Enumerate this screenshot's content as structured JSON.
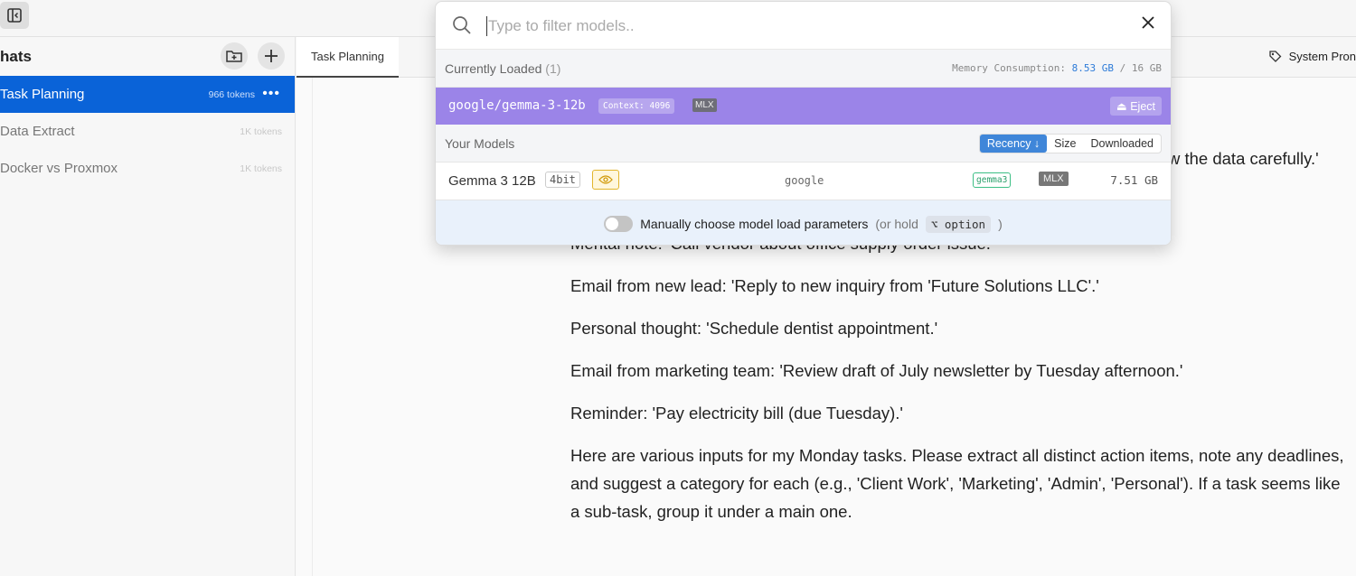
{
  "sidebar": {
    "title": "hats",
    "chats": [
      {
        "name": "Task Planning",
        "tokens": "966 tokens",
        "active": true
      },
      {
        "name": "Data Extract",
        "tokens": "1K tokens",
        "active": false
      },
      {
        "name": "Docker vs Proxmox",
        "tokens": "1K tokens",
        "active": false
      }
    ]
  },
  "tabs": {
    "active": "Task Planning"
  },
  "header": {
    "system_prompt": "System Pron"
  },
  "picker": {
    "search_placeholder": "Type to filter models..",
    "loaded_section": {
      "label": "Currently Loaded",
      "count": "(1)",
      "memory_label": "Memory Consumption:",
      "memory_used": "8.53 GB",
      "memory_sep": "/",
      "memory_total": "16 GB"
    },
    "loaded_model": {
      "name": "google/gemma-3-12b",
      "context": "Context: 4096",
      "format": "MLX",
      "eject": "Eject"
    },
    "your_models": {
      "label": "Your Models",
      "sort_options": [
        "Recency ↓",
        "Size",
        "Downloaded"
      ],
      "active_sort": "Recency ↓"
    },
    "models": [
      {
        "name": "Gemma 3 12B",
        "quant": "4bit",
        "publisher": "google",
        "arch": "gemma3",
        "format": "MLX",
        "size": "7.51 GB"
      }
    ],
    "manual": {
      "label": "Manually choose model load parameters",
      "hint_pre": "(or hold",
      "key": "⌥ option",
      "hint_post": ")"
    }
  },
  "conversation": {
    "lines": [
      "w the data carefully.'",
      "Mental note: 'Call vendor about office supply order issue.'",
      "Email from new lead: 'Reply to new inquiry from 'Future Solutions LLC'.'",
      "Personal thought: 'Schedule dentist appointment.'",
      "Email from marketing team: 'Review draft of July newsletter by Tuesday afternoon.'",
      "Reminder: 'Pay electricity bill (due Tuesday).'",
      "Here are various inputs for my Monday tasks. Please extract all distinct action items, note any deadlines,",
      "and suggest a category for each (e.g., 'Client Work', 'Marketing', 'Admin', 'Personal'). If a task seems like",
      "a sub-task, group it under a main one."
    ]
  }
}
